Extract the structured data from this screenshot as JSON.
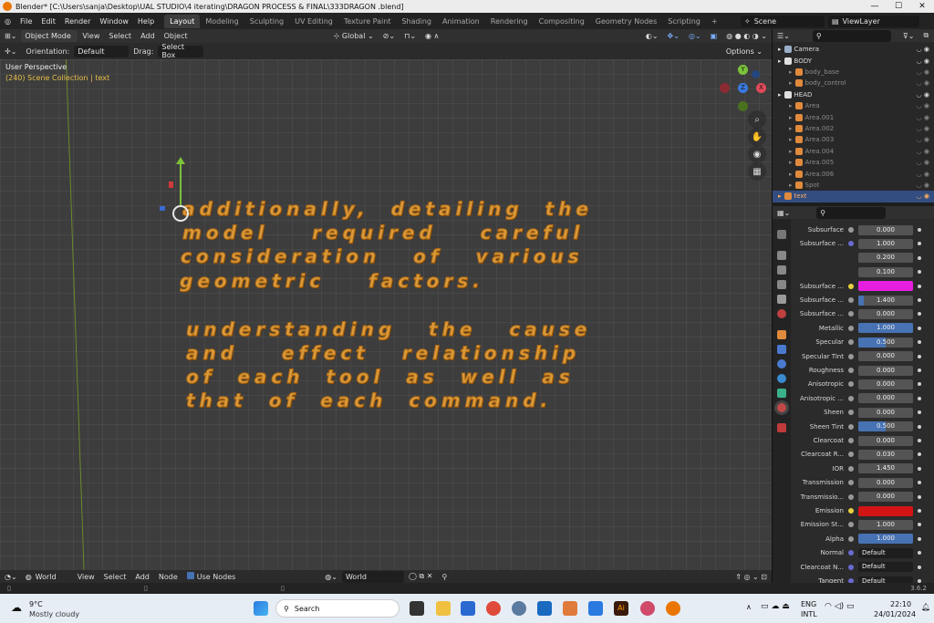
{
  "titlebar": {
    "title": "Blender* [C:\\Users\\sanja\\Desktop\\UAL STUDIO\\4 iterating\\DRAGON PROCESS & FINAL\\333DRAGON .blend]",
    "minimize": "—",
    "maximize": "☐",
    "close": "✕"
  },
  "menu": {
    "items": [
      "File",
      "Edit",
      "Render",
      "Window",
      "Help"
    ]
  },
  "workspaces": [
    "Layout",
    "Modeling",
    "Sculpting",
    "UV Editing",
    "Texture Paint",
    "Shading",
    "Animation",
    "Rendering",
    "Compositing",
    "Geometry Nodes",
    "Scripting",
    "+"
  ],
  "scene": {
    "label": "Scene",
    "viewlayer": "ViewLayer"
  },
  "viewport_header": {
    "mode": "Object Mode",
    "view": "View",
    "select": "Select",
    "add": "Add",
    "object": "Object",
    "transform": "Global",
    "options": "Options ⌄"
  },
  "tool_header": {
    "orientation_label": "Orientation:",
    "orientation": "Default",
    "drag_label": "Drag:",
    "drag": "Select Box"
  },
  "viewport": {
    "perspective": "User Perspective",
    "collection": "(240) Scene Collection | text",
    "text_lines": [
      "additionally,  detailing  the",
      "model    required    careful",
      "consideration   of   various",
      "geometric    factors.",
      "",
      "understanding   the   cause",
      "and    effect   relationship",
      "of  each  tool  as  well  as",
      "that  of  each  command."
    ],
    "gizmo_axes": {
      "x": "X",
      "y": "Y",
      "z": "Z"
    }
  },
  "outliner": {
    "rows": [
      {
        "name": "Camera",
        "dim": false,
        "sel": false,
        "color": "#9ab0c8"
      },
      {
        "name": "BODY",
        "dim": false,
        "sel": false,
        "color": "#e0e0e0"
      },
      {
        "name": "body_base",
        "dim": true,
        "sel": false,
        "color": "#e08a3c"
      },
      {
        "name": "body_control",
        "dim": true,
        "sel": false,
        "color": "#e08a3c"
      },
      {
        "name": "HEAD",
        "dim": false,
        "sel": false,
        "color": "#e0e0e0"
      },
      {
        "name": "Area",
        "dim": true,
        "sel": false,
        "color": "#e08a3c"
      },
      {
        "name": "Area.001",
        "dim": true,
        "sel": false,
        "color": "#e08a3c"
      },
      {
        "name": "Area.002",
        "dim": true,
        "sel": false,
        "color": "#e08a3c"
      },
      {
        "name": "Area.003",
        "dim": true,
        "sel": false,
        "color": "#e08a3c"
      },
      {
        "name": "Area.004",
        "dim": true,
        "sel": false,
        "color": "#e08a3c"
      },
      {
        "name": "Area.005",
        "dim": true,
        "sel": false,
        "color": "#e08a3c"
      },
      {
        "name": "Area.006",
        "dim": true,
        "sel": false,
        "color": "#e08a3c"
      },
      {
        "name": "Spot",
        "dim": true,
        "sel": false,
        "color": "#e08a3c"
      },
      {
        "name": "text",
        "dim": false,
        "sel": true,
        "color": "#e08a3c"
      }
    ]
  },
  "properties": {
    "rows": [
      {
        "label": "Subsurface",
        "value": "0.000",
        "fill": 0,
        "type": "num"
      },
      {
        "label": "Subsurface ...",
        "value": "1.000",
        "fill": 0,
        "type": "num"
      },
      {
        "label": "",
        "value": "0.200",
        "fill": 0,
        "type": "num"
      },
      {
        "label": "",
        "value": "0.100",
        "fill": 0,
        "type": "num"
      },
      {
        "label": "Subsurface ...",
        "value": "",
        "fill": 0,
        "type": "color",
        "color": "#e61ee0"
      },
      {
        "label": "Subsurface ...",
        "value": "1.400",
        "fill": 0.1,
        "type": "num"
      },
      {
        "label": "Subsurface ...",
        "value": "0.000",
        "fill": 0,
        "type": "num"
      },
      {
        "label": "Metallic",
        "value": "1.000",
        "fill": 1,
        "type": "num"
      },
      {
        "label": "Specular",
        "value": "0.500",
        "fill": 0.5,
        "type": "num"
      },
      {
        "label": "Specular Tint",
        "value": "0.000",
        "fill": 0,
        "type": "num"
      },
      {
        "label": "Roughness",
        "value": "0.000",
        "fill": 0,
        "type": "num"
      },
      {
        "label": "Anisotropic",
        "value": "0.000",
        "fill": 0,
        "type": "num"
      },
      {
        "label": "Anisotropic ...",
        "value": "0.000",
        "fill": 0,
        "type": "num"
      },
      {
        "label": "Sheen",
        "value": "0.000",
        "fill": 0,
        "type": "num"
      },
      {
        "label": "Sheen Tint",
        "value": "0.500",
        "fill": 0.5,
        "type": "num"
      },
      {
        "label": "Clearcoat",
        "value": "0.000",
        "fill": 0,
        "type": "num"
      },
      {
        "label": "Clearcoat R...",
        "value": "0.030",
        "fill": 0,
        "type": "num"
      },
      {
        "label": "IOR",
        "value": "1.450",
        "fill": 0,
        "type": "num"
      },
      {
        "label": "Transmission",
        "value": "0.000",
        "fill": 0,
        "type": "num"
      },
      {
        "label": "Transmissio...",
        "value": "0.000",
        "fill": 0,
        "type": "num"
      },
      {
        "label": "Emission",
        "value": "",
        "fill": 0,
        "type": "color",
        "color": "#d21414"
      },
      {
        "label": "Emission St...",
        "value": "1.000",
        "fill": 0,
        "type": "num"
      },
      {
        "label": "Alpha",
        "value": "1.000",
        "fill": 1,
        "type": "num"
      },
      {
        "label": "Normal",
        "value": "Default",
        "fill": 0,
        "type": "node"
      },
      {
        "label": "Clearcoat N...",
        "value": "Default",
        "fill": 0,
        "type": "node"
      },
      {
        "label": "Tangent",
        "value": "Default",
        "fill": 0,
        "type": "node"
      }
    ]
  },
  "node_header": {
    "world_type": "World",
    "view": "View",
    "select": "Select",
    "add": "Add",
    "node": "Node",
    "use_nodes": "Use Nodes",
    "world_name": "World"
  },
  "status": {
    "version": "3.6.2"
  },
  "taskbar": {
    "temp": "9°C",
    "weather": "Mostly cloudy",
    "search": "Search",
    "lang1": "ENG",
    "lang2": "INTL",
    "time": "22:10",
    "date": "24/01/2024"
  }
}
